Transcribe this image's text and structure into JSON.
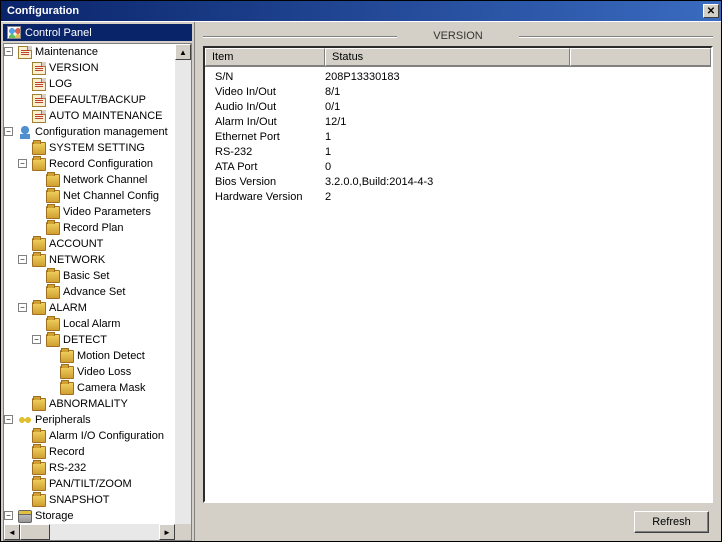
{
  "window": {
    "title": "Configuration"
  },
  "tree": {
    "root": "Control Panel",
    "n_maintenance": "Maintenance",
    "n_version": "VERSION",
    "n_log": "LOG",
    "n_default": "DEFAULT/BACKUP",
    "n_automaint": "AUTO MAINTENANCE",
    "n_configmgmt": "Configuration management",
    "n_system": "SYSTEM SETTING",
    "n_recconf": "Record Configuration",
    "n_netchan": "Network Channel",
    "n_netchconf": "Net Channel Config",
    "n_vparam": "Video Parameters",
    "n_recplan": "Record Plan",
    "n_account": "ACCOUNT",
    "n_network": "NETWORK",
    "n_basicset": "Basic Set",
    "n_advset": "Advance Set",
    "n_alarm": "ALARM",
    "n_localalarm": "Local Alarm",
    "n_detect": "DETECT",
    "n_motion": "Motion Detect",
    "n_vloss": "Video Loss",
    "n_cmask": "Camera Mask",
    "n_abnorm": "ABNORMALITY",
    "n_periph": "Peripherals",
    "n_alarmio": "Alarm I/O Configuration",
    "n_record": "Record",
    "n_rs232": "RS-232",
    "n_ptz": "PAN/TILT/ZOOM",
    "n_snapshot": "SNAPSHOT",
    "n_storage": "Storage"
  },
  "panel": {
    "heading": "VERSION",
    "col_item": "Item",
    "col_status": "Status",
    "rows": [
      {
        "item": "S/N",
        "status": "208P13330183"
      },
      {
        "item": "Video In/Out",
        "status": "8/1"
      },
      {
        "item": "Audio In/Out",
        "status": "0/1"
      },
      {
        "item": "Alarm In/Out",
        "status": "12/1"
      },
      {
        "item": "Ethernet Port",
        "status": "1"
      },
      {
        "item": "RS-232",
        "status": "1"
      },
      {
        "item": "ATA Port",
        "status": "0"
      },
      {
        "item": "Bios Version",
        "status": "3.2.0.0,Build:2014-4-3"
      },
      {
        "item": "Hardware Version",
        "status": "2"
      }
    ],
    "refresh": "Refresh"
  }
}
